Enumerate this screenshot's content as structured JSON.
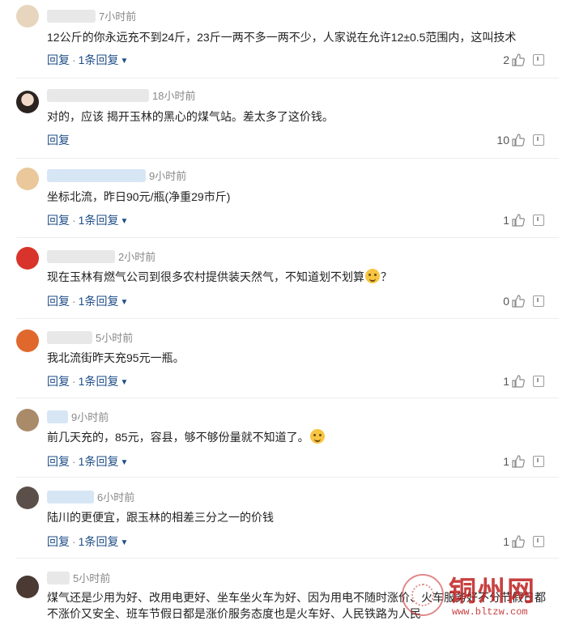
{
  "comments": [
    {
      "avatar_color": "#e7d5bd",
      "time": "7小时前",
      "text": "12公斤的你永远充不到24斤，23斤一两不多一两不少，人家说在允许12±0.5范围内，这叫技术",
      "reply_label": "回复",
      "replies_label": "1条回复",
      "likes": "2"
    },
    {
      "avatar_color": "#c9b6a6",
      "time": "18小时前",
      "text": "对的，应该 揭开玉林的黑心的煤气站。差太多了这价钱。",
      "reply_label": "回复",
      "replies_label": "",
      "likes": "10"
    },
    {
      "avatar_color": "#eac89c",
      "time": "9小时前",
      "text": "坐标北流，昨日90元/瓶(净重29市斤)",
      "reply_label": "回复",
      "replies_label": "1条回复",
      "likes": "1"
    },
    {
      "avatar_color": "#d9342b",
      "time": "2小时前",
      "text": "现在玉林有燃气公司到很多农村提供装天然气，不知道划不划算",
      "text_suffix": "？",
      "reply_label": "回复",
      "replies_label": "1条回复",
      "likes": "0"
    },
    {
      "avatar_color": "#e0682c",
      "time": "5小时前",
      "text": "我北流街昨天充95元一瓶。",
      "reply_label": "回复",
      "replies_label": "1条回复",
      "likes": "1"
    },
    {
      "avatar_color": "#a98b6a",
      "time": "9小时前",
      "text": "前几天充的，85元，容县，够不够份量就不知道了。",
      "reply_label": "回复",
      "replies_label": "1条回复",
      "likes": "1"
    },
    {
      "avatar_color": "#5a4f49",
      "time": "6小时前",
      "text": "陆川的更便宜，跟玉林的相差三分之一的价钱",
      "reply_label": "回复",
      "replies_label": "1条回复",
      "likes": "1"
    },
    {
      "avatar_color": "#4a3a33",
      "time": "5小时前",
      "text": "煤气还是少用为好、改用电更好、坐车坐火车为好、因为用电不随时涨价、火车服务好不分节假日都不涨价又安全、班车节假日都是涨价服务态度也是火车好、人民铁路为人民",
      "reply_label": "",
      "replies_label": "",
      "likes": ""
    }
  ],
  "watermark": {
    "title": "铜州网",
    "url": "www.bltzw.com"
  }
}
